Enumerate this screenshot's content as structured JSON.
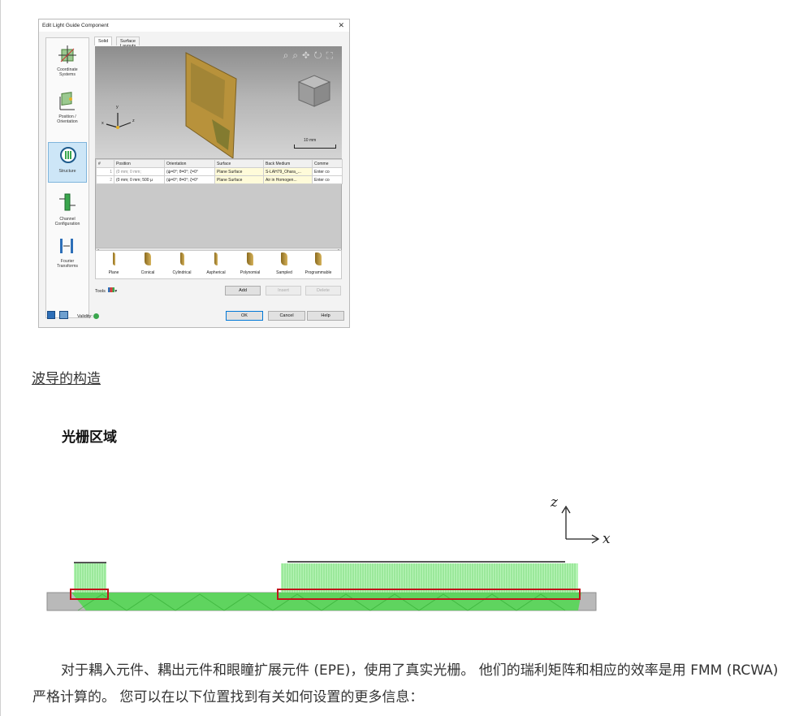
{
  "dialog": {
    "title": "Edit Light Guide Component",
    "close_glyph": "✕",
    "nav": [
      {
        "label_line1": "Coordinate",
        "label_line2": "Systems"
      },
      {
        "label_line1": "Position /",
        "label_line2": "Orientation"
      },
      {
        "label_line1": "Structure",
        "label_line2": ""
      },
      {
        "label_line1": "Channel",
        "label_line2": "Configuration"
      },
      {
        "label_line1": "Fourier",
        "label_line2": "Transforms"
      }
    ],
    "tabs": [
      "Solid",
      "Surface Layouts"
    ],
    "viewport": {
      "scale_label": "10 mm",
      "tool_glyphs": "⌕⌕✥↻⛶",
      "axis_x": "x",
      "axis_y": "y",
      "axis_z": "z"
    },
    "table": {
      "headers": [
        "#",
        "Position",
        "Orientation",
        "Surface",
        "Back Medium",
        "Comme"
      ],
      "rows": [
        [
          "1",
          "(0 mm; 0 mm;",
          "(ψ=0°; θ=0°; ζ=0°",
          "Plane Surface",
          "S-LAH79_Ohara_...",
          "Enter co"
        ],
        [
          "2",
          "(0 mm; 0 mm; 500 µ",
          "(ψ=0°; θ=0°; ζ=0°",
          "Plane Surface",
          "Air in Homogen...",
          "Enter co"
        ]
      ]
    },
    "shapes": [
      "Plane",
      "Conical",
      "Cylindrical",
      "Aspherical",
      "Polynomial",
      "Sampled",
      "Programmable"
    ],
    "tools_label": "Tools",
    "buttons": {
      "add": "Add",
      "insert": "Insert",
      "delete": "Delete",
      "ok": "OK",
      "cancel": "Cancel",
      "help": "Help"
    },
    "validity_label": "Validity:"
  },
  "article": {
    "link_heading": "波导的构造",
    "section_heading": "光栅区域",
    "paragraph": "对于耦入元件、耦出元件和眼瞳扩展元件 (EPE)，使用了真实光栅。 他们的瑞利矩阵和相应的效率是用 FMM (RCWA) 严格计算的。 您可以在以下位置找到有关如何设置的更多信息："
  },
  "diagram": {
    "axis_z": "z",
    "axis_x": "x",
    "colors": {
      "substrate": "#b9b9b9",
      "light": "#4fd84f",
      "grating": "#7ee87e",
      "highlight": "#c0161c"
    }
  }
}
